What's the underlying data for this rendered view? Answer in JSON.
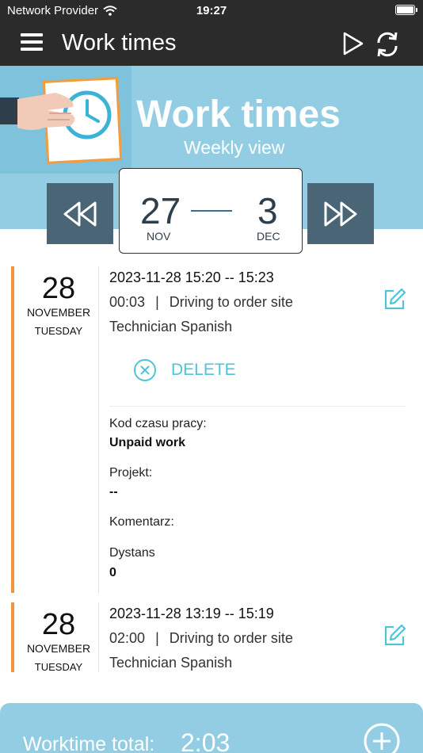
{
  "status_bar": {
    "carrier": "Network Provider",
    "time": "19:27"
  },
  "app_bar": {
    "title": "Work times"
  },
  "hero": {
    "title": "Work times",
    "subtitle": "Weekly view"
  },
  "week": {
    "start_day": "27",
    "start_month": "NOV",
    "end_day": "3",
    "end_month": "DEC"
  },
  "entries": [
    {
      "day": "28",
      "month": "NOVEMBER",
      "weekday": "TUESDAY",
      "datetime": "2023-11-28 15:20 -- 15:23",
      "duration": "00:03",
      "separator": "|",
      "activity": "Driving to order site",
      "role": "Technician Spanish",
      "delete_label": "DELETE",
      "fields": [
        {
          "label": "Kod czasu pracy:",
          "value": "Unpaid work"
        },
        {
          "label": "Projekt:",
          "value": "--"
        },
        {
          "label": "Komentarz:",
          "value": ""
        },
        {
          "label": "Dystans",
          "value": "0"
        }
      ]
    },
    {
      "day": "28",
      "month": "NOVEMBER",
      "weekday": "TUESDAY",
      "datetime": "2023-11-28 13:19 -- 15:19",
      "duration": "02:00",
      "separator": "|",
      "activity": "Driving to order site",
      "role": "Technician Spanish"
    }
  ],
  "footer": {
    "label": "Worktime total:",
    "value": "2:03"
  },
  "colors": {
    "dark": "#2b2b2b",
    "hero": "#92cde3",
    "nav": "#4a6576",
    "accent": "#4fc4d9",
    "stripe": "#f5923e"
  },
  "icons": [
    "menu-icon",
    "play-icon",
    "sync-icon",
    "rewind-icon",
    "fast-forward-icon",
    "edit-icon",
    "delete-icon",
    "add-icon",
    "wifi-icon",
    "battery-icon"
  ]
}
